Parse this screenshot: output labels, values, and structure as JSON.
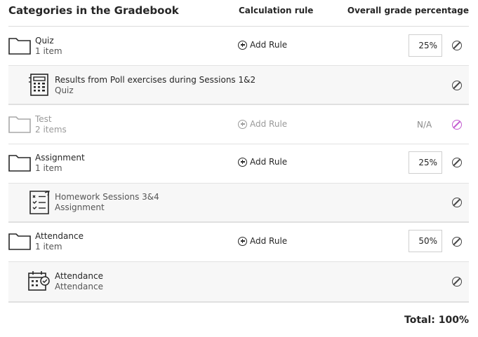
{
  "header": {
    "title": "Categories in the Gradebook",
    "calc_rule": "Calculation rule",
    "overall_pct": "Overall grade percentage"
  },
  "rows": [
    {
      "type": "category",
      "name": "Quiz",
      "sub": "1 item",
      "rule": "Add Rule",
      "percent": "25",
      "pct_symbol": "%"
    },
    {
      "type": "item",
      "name": "Results from Poll exercises during Sessions 1&2",
      "sub": "Quiz",
      "icon": "calculator-icon"
    },
    {
      "type": "category",
      "name": "Test",
      "sub": "2 items",
      "rule": "Add Rule",
      "percent": "N/A",
      "disabled": true
    },
    {
      "type": "category",
      "name": "Assignment",
      "sub": "1 item",
      "rule": "Add Rule",
      "percent": "25",
      "pct_symbol": "%"
    },
    {
      "type": "item",
      "name": "Homework Sessions 3&4",
      "sub": "Assignment",
      "icon": "checklist-icon"
    },
    {
      "type": "category",
      "name": "Attendance",
      "sub": "1 item",
      "rule": "Add Rule",
      "percent": "50",
      "pct_symbol": "%"
    },
    {
      "type": "item",
      "name": "Attendance",
      "sub": "Attendance",
      "icon": "calendar-check-icon"
    }
  ],
  "total": "Total: 100%",
  "colors": {
    "disabled_ban": "#c35bd0",
    "text": "#262626",
    "item_bg": "#f7f7f7"
  }
}
